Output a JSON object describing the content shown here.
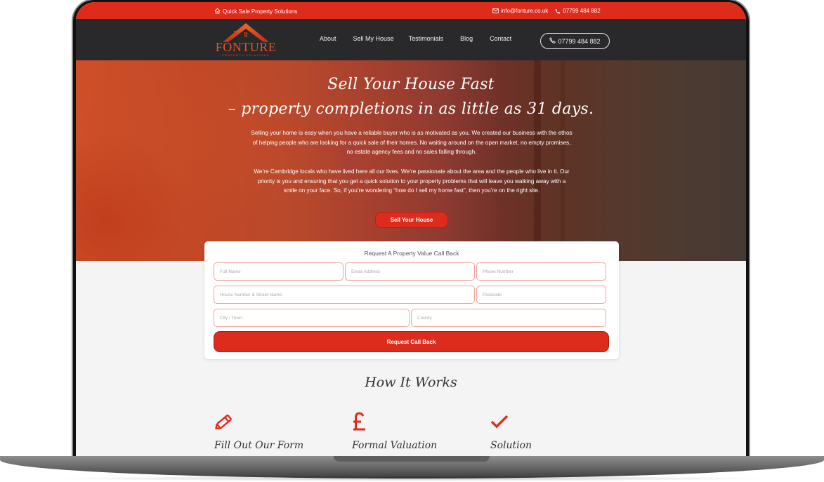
{
  "topbar": {
    "tagline": "Quick Sale Property Solutions",
    "tagline_icon": "house-icon",
    "email": "info@fonture.co.uk",
    "email_icon": "envelope-icon",
    "phone": "07799 484 882",
    "phone_icon": "phone-icon"
  },
  "nav": {
    "logo": {
      "name": "FONTURE",
      "subtitle": "PROPERTY SOLUTIONS"
    },
    "items": [
      {
        "label": "About"
      },
      {
        "label": "Sell My House"
      },
      {
        "label": "Testimonials"
      },
      {
        "label": "Blog"
      },
      {
        "label": "Contact"
      }
    ],
    "phone_button": "07799 484 882"
  },
  "hero": {
    "title_line1": "Sell Your House Fast",
    "title_line2": "– property completions in as little as 31 days.",
    "paragraph1": "Selling your home is easy when you have a reliable buyer who is as motivated as you. We created our business with the ethos of helping people who are looking for a quick sale of their homes. No waiting around on the open market, no empty promises, no estate agency fees and no sales falling through.",
    "paragraph2": "We’re Cambridge locals who have lived here all our lives. We’re passionate about the area and the people who live in it. Our priority is you and ensuring that you get a quick solution to your property problems that will leave you walking away with a smile on your face. So, if you’re wondering “how do I sell my home fast”, then you’re on the right site.",
    "cta_label": "Sell Your House"
  },
  "form": {
    "title": "Request A Property Value Call Back",
    "fields": {
      "full_name": {
        "placeholder": "Full Name",
        "value": ""
      },
      "email": {
        "placeholder": "Email Address",
        "value": ""
      },
      "phone": {
        "placeholder": "Phone Number",
        "value": ""
      },
      "street": {
        "placeholder": "House Number & Street Name",
        "value": ""
      },
      "postcode": {
        "placeholder": "Postcode",
        "value": ""
      },
      "city": {
        "placeholder": "City / Town",
        "value": ""
      },
      "county": {
        "placeholder": "County",
        "value": ""
      }
    },
    "submit_label": "Request Call Back"
  },
  "how_it_works": {
    "title": "How It Works",
    "steps": [
      {
        "label": "Fill Out Our Form",
        "icon": "pencil-icon"
      },
      {
        "label": "Formal Valuation",
        "icon": "pound-icon"
      },
      {
        "label": "Solution",
        "icon": "checkmark-icon"
      }
    ]
  },
  "colors": {
    "brand_red": "#dd2c1c",
    "nav_dark": "#29292b",
    "field_border": "#f0a299",
    "page_bg": "#f4f4f4"
  }
}
